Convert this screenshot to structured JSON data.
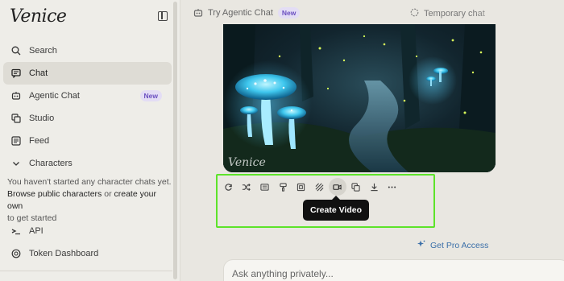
{
  "app": {
    "logo_text": "Venice"
  },
  "sidebar": {
    "items": [
      {
        "label": "Search",
        "icon": "search-icon"
      },
      {
        "label": "Chat",
        "icon": "chat-icon",
        "active": true
      },
      {
        "label": "Agentic Chat",
        "icon": "robot-icon",
        "badge": "New"
      },
      {
        "label": "Studio",
        "icon": "studio-icon"
      },
      {
        "label": "Feed",
        "icon": "feed-icon"
      },
      {
        "label": "Characters",
        "icon": "chevron-down-icon"
      },
      {
        "label": "API",
        "icon": "api-icon"
      },
      {
        "label": "Token Dashboard",
        "icon": "token-icon"
      }
    ],
    "characters_note": {
      "line1": "You haven't started any character chats yet.",
      "browse_link": "Browse public characters",
      "or_text": " or ",
      "create_link": "create your own",
      "line3": "to get started"
    }
  },
  "topbar": {
    "try_agentic_label": "Try Agentic Chat",
    "try_agentic_badge": "New",
    "temporary_chat_label": "Temporary chat"
  },
  "image": {
    "watermark": "Venice"
  },
  "toolbar": {
    "buttons": [
      {
        "name": "regenerate-button",
        "icon": "refresh-icon"
      },
      {
        "name": "remix-button",
        "icon": "shuffle-icon"
      },
      {
        "name": "details-button",
        "icon": "details-icon"
      },
      {
        "name": "edit-style-button",
        "icon": "paint-brush-icon"
      },
      {
        "name": "upscale-button",
        "icon": "upscale-icon"
      },
      {
        "name": "background-button",
        "icon": "pattern-icon"
      },
      {
        "name": "create-video-button",
        "icon": "video-icon"
      },
      {
        "name": "copy-button",
        "icon": "copy-icon"
      },
      {
        "name": "download-button",
        "icon": "download-icon"
      },
      {
        "name": "more-button",
        "icon": "more-icon"
      }
    ],
    "tooltip": "Create Video"
  },
  "pro_link": "Get Pro Access",
  "composer": {
    "placeholder": "Ask anything privately..."
  },
  "colors": {
    "highlight": "#5de32a",
    "accent_badge": "#6a4fc0",
    "link": "#3a6fa8"
  }
}
